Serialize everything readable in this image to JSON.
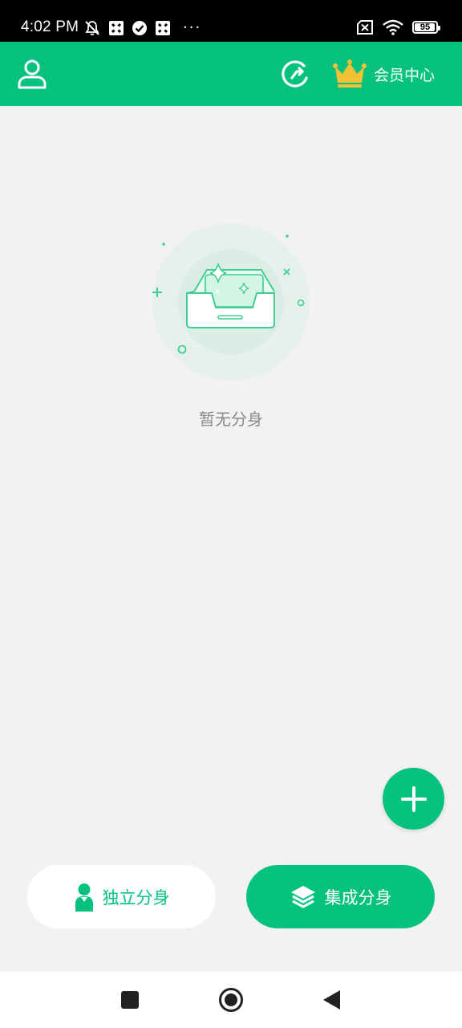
{
  "status_bar": {
    "time": "4:02 PM",
    "left_icons": [
      "muted-bell-icon",
      "app-notification-icon",
      "check-circle-icon",
      "app-notification-icon"
    ],
    "more_indicator": "···",
    "right_icons": [
      "sim-off-icon",
      "wifi-icon"
    ],
    "battery_level": "95",
    "battery_fraction": 0.95
  },
  "app_bar": {
    "color": "#07c27f",
    "profile_icon": "user-outline-icon",
    "refresh_icon": "refresh-icon",
    "member_icon": "crown-icon",
    "member_label": "会员中心"
  },
  "empty_state": {
    "illustration": "empty-inbox-icon",
    "text": "暂无分身"
  },
  "fab": {
    "icon": "plus-icon"
  },
  "mode_buttons": {
    "independent": {
      "label": "独立分身",
      "icon": "person-icon"
    },
    "integrated": {
      "label": "集成分身",
      "icon": "layers-icon"
    }
  },
  "nav_bar": {
    "recents": "recents-square-icon",
    "home": "home-circle-icon",
    "back": "back-triangle-icon"
  },
  "colors": {
    "accent": "#07c27f",
    "background": "#f2f2f2",
    "crown": "#f5c033",
    "empty_text": "#8a8a8a"
  }
}
